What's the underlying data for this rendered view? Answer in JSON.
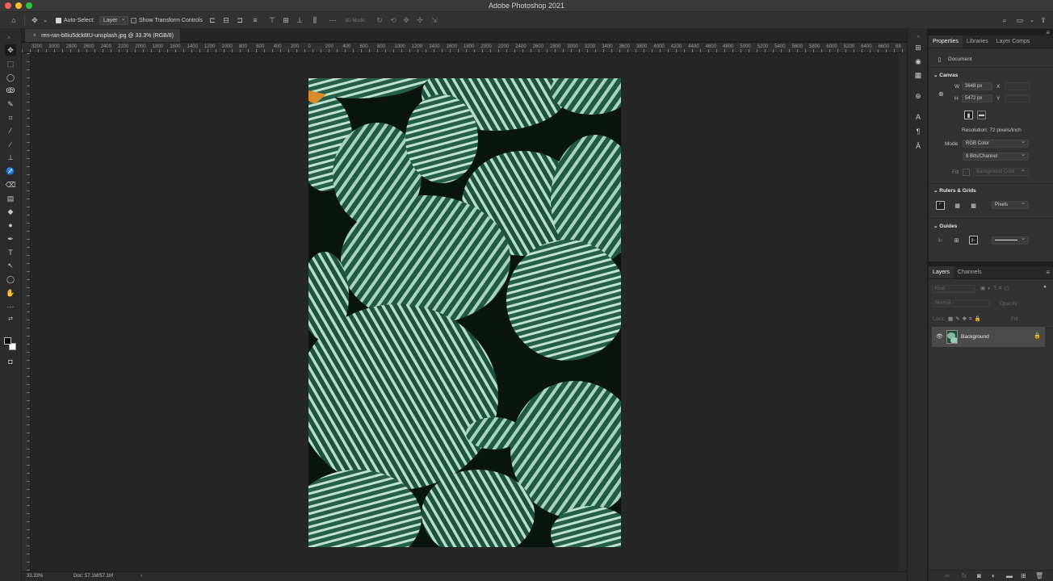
{
  "app": {
    "title": "Adobe Photoshop 2021"
  },
  "options_bar": {
    "auto_select_label": "Auto-Select:",
    "auto_select_target": "Layer",
    "show_transform_label": "Show Transform Controls",
    "mode_3d_label": "3D Mode:"
  },
  "document": {
    "tab_title": "ren-ran-b8iu5dck8tU-unsplash.jpg @ 33.3% (RGB/8)",
    "tab_close": "×"
  },
  "ruler": {
    "h_labels": [
      "3200",
      "3000",
      "2800",
      "2600",
      "2400",
      "2200",
      "2000",
      "1800",
      "1600",
      "1400",
      "1200",
      "1000",
      "800",
      "600",
      "400",
      "200",
      "0",
      "200",
      "400",
      "600",
      "800",
      "1000",
      "1200",
      "1400",
      "1600",
      "1800",
      "2000",
      "2200",
      "2400",
      "2600",
      "2800",
      "3000",
      "3200",
      "3400",
      "3600",
      "3800",
      "4000",
      "4200",
      "4400",
      "4600",
      "4800",
      "5000",
      "5200",
      "5400",
      "5600",
      "5800",
      "6000",
      "6200",
      "6400",
      "6600",
      "68"
    ]
  },
  "status": {
    "zoom": "33.33%",
    "doc": "Doc: 57.1M/57.1M",
    "arrow": "›"
  },
  "properties": {
    "tabs": [
      "Properties",
      "Libraries",
      "Layer Comps"
    ],
    "doc_label": "Document",
    "canvas_head": "Canvas",
    "w_label": "W",
    "w_value": "3648 px",
    "h_label": "H",
    "h_value": "5472 px",
    "x_label": "X",
    "y_label": "Y",
    "resolution": "Resolution: 72 pixels/inch",
    "mode_label": "Mode",
    "mode_value": "RGB Color",
    "depth_value": "8 Bits/Channel",
    "fill_label": "Fill",
    "fill_value": "Background Color",
    "rulers_head": "Rulers & Grids",
    "units_value": "Pixels",
    "guides_head": "Guides"
  },
  "layers": {
    "tabs": [
      "Layers",
      "Channels"
    ],
    "kind_placeholder": "Kind",
    "blend_mode": "Normal",
    "opacity_label": "Opacity:",
    "lock_label": "Lock:",
    "fill_label": "Fill:",
    "items": [
      {
        "name": "Background",
        "visible": true,
        "locked": true
      }
    ]
  },
  "colors": {
    "accent": "#28c840",
    "canvas_bg": "#262626",
    "panel_bg": "#323232"
  }
}
